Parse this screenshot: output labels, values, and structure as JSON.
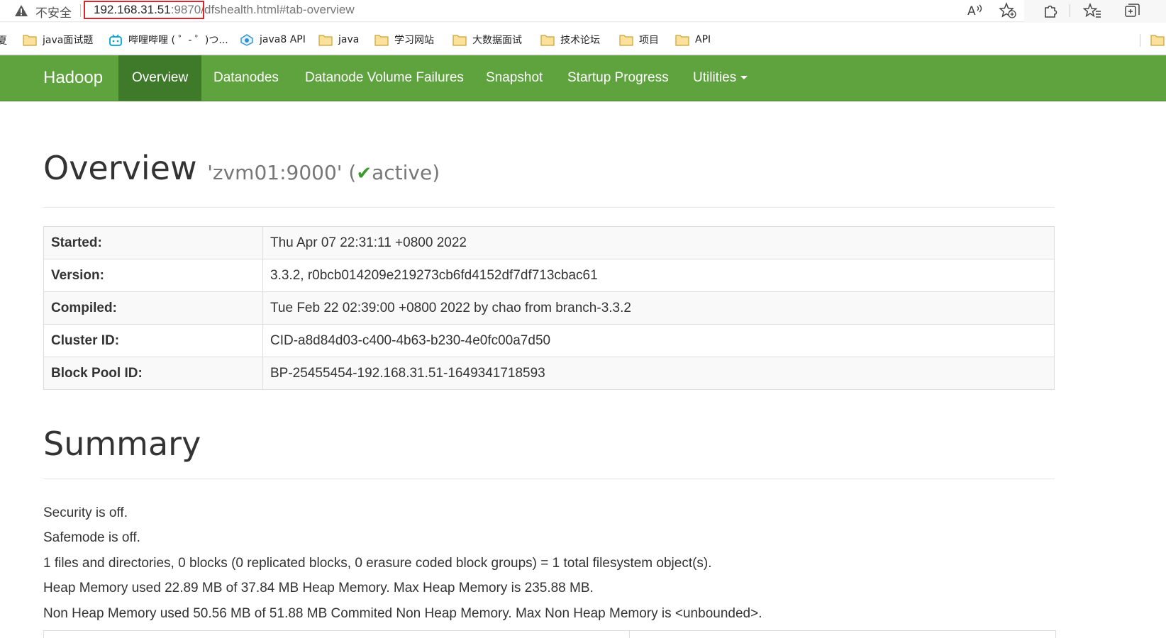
{
  "browser": {
    "insecure_label": "不安全",
    "url": {
      "host": "192.168.31.51",
      "port": ":9870",
      "path": "/dfshealth.html#tab-overview"
    },
    "toolbar_icons": [
      "read-aloud-icon",
      "add-favorite-icon",
      "extensions-icon",
      "favorites-icon",
      "collections-icon"
    ],
    "bookmarks": [
      {
        "label": "java面试题",
        "icon": "folder-icon"
      },
      {
        "label": "哔哩哔哩 ( ゜- ゜)つ...",
        "icon": "bilibili-icon"
      },
      {
        "label": "java8 API",
        "icon": "site-icon"
      },
      {
        "label": "java",
        "icon": "folder-icon"
      },
      {
        "label": "学习网站",
        "icon": "folder-icon"
      },
      {
        "label": "大数据面试",
        "icon": "folder-icon"
      },
      {
        "label": "技术论坛",
        "icon": "folder-icon"
      },
      {
        "label": "项目",
        "icon": "folder-icon"
      },
      {
        "label": "API",
        "icon": "folder-icon"
      }
    ],
    "bookmark_cut_label": "夏"
  },
  "navbar": {
    "brand": "Hadoop",
    "items": [
      {
        "label": "Overview",
        "active": true
      },
      {
        "label": "Datanodes"
      },
      {
        "label": "Datanode Volume Failures"
      },
      {
        "label": "Snapshot"
      },
      {
        "label": "Startup Progress"
      },
      {
        "label": "Utilities"
      }
    ],
    "color": "#5fa33e",
    "active_color": "#3e7a2a"
  },
  "overview": {
    "title": "Overview",
    "namenode": "'zvm01:9000'",
    "status_open": "(",
    "status_check": "✔",
    "status": "active)",
    "rows": [
      {
        "key": "Started:",
        "value": "Thu Apr 07 22:31:11 +0800 2022"
      },
      {
        "key": "Version:",
        "value": "3.3.2, r0bcb014209e219273cb6fd4152df7df713cbac61"
      },
      {
        "key": "Compiled:",
        "value": "Tue Feb 22 02:39:00 +0800 2022 by chao from branch-3.3.2"
      },
      {
        "key": "Cluster ID:",
        "value": "CID-a8d84d03-c400-4b63-b230-4e0fc00a7d50"
      },
      {
        "key": "Block Pool ID:",
        "value": "BP-25455454-192.168.31.51-1649341718593"
      }
    ]
  },
  "summary": {
    "title": "Summary",
    "lines": [
      "Security is off.",
      "Safemode is off.",
      "1 files and directories, 0 blocks (0 replicated blocks, 0 erasure coded block groups) = 1 total filesystem object(s).",
      "Heap Memory used 22.89 MB of 37.84 MB Heap Memory. Max Heap Memory is 235.88 MB.",
      "Non Heap Memory used 50.56 MB of 51.88 MB Commited Non Heap Memory. Max Non Heap Memory is <unbounded>."
    ]
  }
}
